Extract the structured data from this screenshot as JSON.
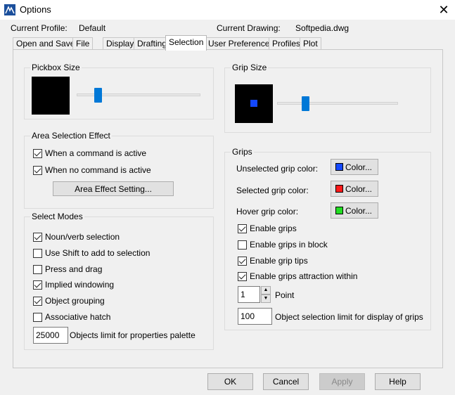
{
  "window": {
    "title": "Options"
  },
  "profile": {
    "current_profile_label": "Current Profile:",
    "current_profile_value": "Default",
    "current_drawing_label": "Current Drawing:",
    "current_drawing_value": "Softpedia.dwg"
  },
  "tabs": [
    "Open and Save",
    "File",
    "Display",
    "Drafting",
    "Selection",
    "User Preferences",
    "Profiles",
    "Plot"
  ],
  "active_tab": "Selection",
  "pickbox": {
    "title": "Pickbox Size",
    "slider_fraction": 0.17
  },
  "grip_size": {
    "title": "Grip Size",
    "slider_fraction": 0.23
  },
  "area_selection": {
    "title": "Area Selection Effect",
    "options": [
      {
        "label": "When a command is active",
        "checked": true
      },
      {
        "label": "When no command is active",
        "checked": true
      }
    ],
    "button_label": "Area Effect Setting..."
  },
  "select_modes": {
    "title": "Select Modes",
    "options": [
      {
        "label": "Noun/verb selection",
        "checked": true
      },
      {
        "label": "Use Shift to add to selection",
        "checked": false
      },
      {
        "label": "Press and drag",
        "checked": false
      },
      {
        "label": "Implied windowing",
        "checked": true
      },
      {
        "label": "Object grouping",
        "checked": true
      },
      {
        "label": "Associative hatch",
        "checked": false
      }
    ],
    "objects_limit_value": "25000",
    "objects_limit_label": "Objects limit for properties palette"
  },
  "grips": {
    "title": "Grips",
    "colors": [
      {
        "label": "Unselected grip color:",
        "button": "Color...",
        "swatch": "#1448ff"
      },
      {
        "label": "Selected grip color:",
        "button": "Color...",
        "swatch": "#ff1a1a"
      },
      {
        "label": "Hover grip color:",
        "button": "Color...",
        "swatch": "#22dd22"
      }
    ],
    "options": [
      {
        "label": "Enable grips",
        "checked": true
      },
      {
        "label": "Enable grips in block",
        "checked": false
      },
      {
        "label": "Enable grip tips",
        "checked": true
      },
      {
        "label": "Enable grips attraction within",
        "checked": true
      }
    ],
    "point_value": "1",
    "point_label": "Point",
    "limit_value": "100",
    "limit_label": "Object selection limit for display of grips"
  },
  "footer": {
    "ok": "OK",
    "cancel": "Cancel",
    "apply": "Apply",
    "help": "Help"
  },
  "colors": {
    "accent": "#0078d7",
    "grip_preview": "#1448ff"
  }
}
